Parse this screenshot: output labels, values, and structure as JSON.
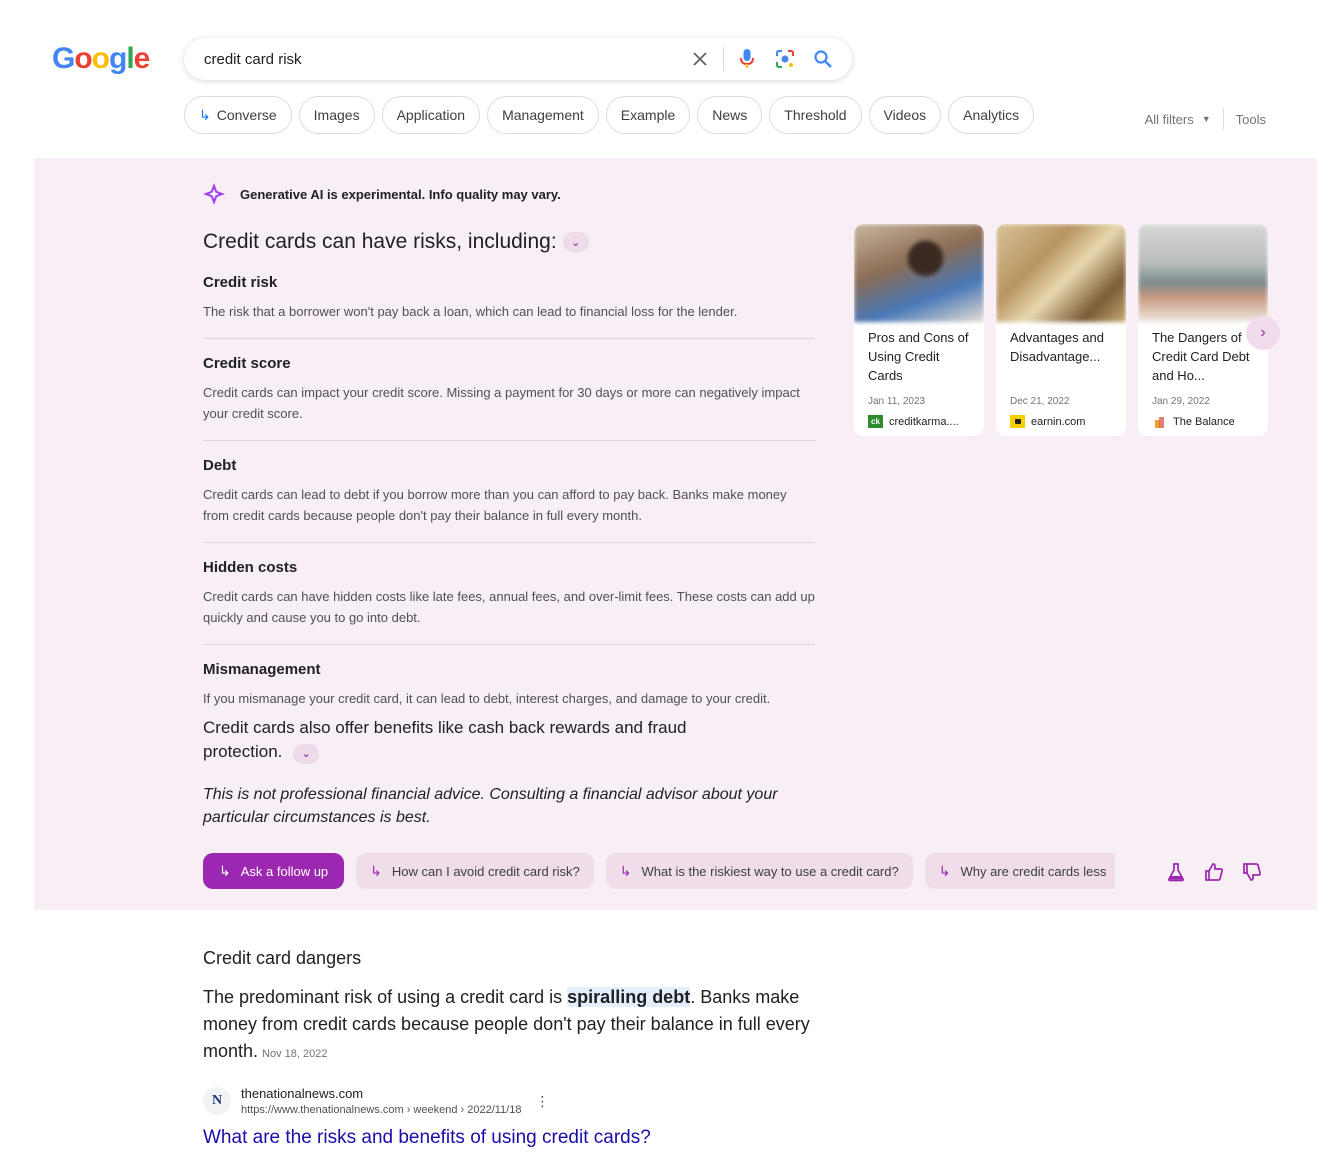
{
  "logo": {
    "letters": [
      "G",
      "o",
      "o",
      "g",
      "l",
      "e"
    ],
    "colors": [
      "#4285F4",
      "#EA4335",
      "#FBBC05",
      "#4285F4",
      "#34A853",
      "#EA4335"
    ]
  },
  "search": {
    "query": "credit card risk"
  },
  "chips": [
    "Converse",
    "Images",
    "Application",
    "Management",
    "Example",
    "News",
    "Threshold",
    "Videos",
    "Analytics"
  ],
  "filters": {
    "all_filters": "All filters",
    "tools": "Tools"
  },
  "ai": {
    "notice": "Generative AI is experimental. Info quality may vary.",
    "title": "Credit cards can have risks, including:",
    "items": [
      {
        "heading": "Credit risk",
        "text": "The risk that a borrower won't pay back a loan, which can lead to financial loss for the lender."
      },
      {
        "heading": "Credit score",
        "text": "Credit cards can impact your credit score. Missing a payment for 30 days or more can negatively impact your credit score."
      },
      {
        "heading": "Debt",
        "text": "Credit cards can lead to debt if you borrow more than you can afford to pay back. Banks make money from credit cards because people don't pay their balance in full every month."
      },
      {
        "heading": "Hidden costs",
        "text": "Credit cards can have hidden costs like late fees, annual fees, and over-limit fees. These costs can add up quickly and cause you to go into debt."
      },
      {
        "heading": "Mismanagement",
        "text": "If you mismanage your credit card, it can lead to debt, interest charges, and damage to your credit."
      }
    ],
    "benefits": "Credit cards also offer benefits like cash back rewards and fraud protection.",
    "disclaimer": "This is not professional financial advice. Consulting a financial advisor about your particular circumstances is best.",
    "cards": [
      {
        "title": "Pros and Cons of Using Credit Cards",
        "date": "Jan 11, 2023",
        "source": "creditkarma....",
        "fav": "ck",
        "fav_color": "#2e8b2e"
      },
      {
        "title": "Advantages and Disadvantage...",
        "date": "Dec 21, 2022",
        "source": "earnin.com",
        "fav": "",
        "fav_color": "#f4d000"
      },
      {
        "title": "The Dangers of Credit Card Debt and Ho...",
        "date": "Jan 29, 2022",
        "source": "The Balance",
        "fav": "",
        "fav_color": "#f0a030"
      }
    ],
    "followups": {
      "ask": "Ask a follow up",
      "suggestions": [
        "How can I avoid credit card risk?",
        "What is the riskiest way to use a credit card?",
        "Why are credit cards less"
      ]
    }
  },
  "snippet": {
    "heading": "Credit card dangers",
    "before": "The predominant risk of using a credit card is ",
    "highlight": "spiralling debt",
    "after": ". Banks make money from credit cards because people don't pay their balance in full every month.",
    "date": "Nov 18, 2022",
    "site": "thenationalnews.com",
    "url": "https://www.thenationalnews.com › weekend › 2022/11/18",
    "fav": "N",
    "link": "What are the risks and benefits of using credit cards?"
  }
}
